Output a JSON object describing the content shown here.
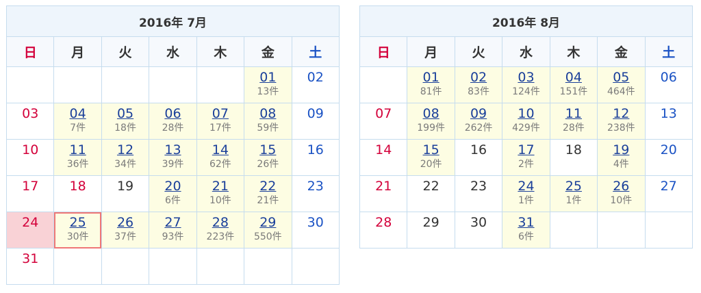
{
  "weekday_labels": [
    "日",
    "月",
    "火",
    "水",
    "木",
    "金",
    "土"
  ],
  "colors": {
    "sunday": "#d3003a",
    "saturday": "#1a52c4",
    "link": "#1a3f9a",
    "highlight": "#fdfde3",
    "today": "#f9d2d6",
    "selected_border": "#ef7676"
  },
  "calendars": [
    {
      "title": "2016年 7月",
      "weeks": [
        [
          null,
          null,
          null,
          null,
          null,
          {
            "day": "01",
            "count": "13件"
          },
          {
            "day": "02"
          }
        ],
        [
          {
            "day": "03"
          },
          {
            "day": "04",
            "count": "7件"
          },
          {
            "day": "05",
            "count": "18件"
          },
          {
            "day": "06",
            "count": "28件"
          },
          {
            "day": "07",
            "count": "17件"
          },
          {
            "day": "08",
            "count": "59件"
          },
          {
            "day": "09"
          }
        ],
        [
          {
            "day": "10"
          },
          {
            "day": "11",
            "count": "36件"
          },
          {
            "day": "12",
            "count": "34件"
          },
          {
            "day": "13",
            "count": "39件"
          },
          {
            "day": "14",
            "count": "62件"
          },
          {
            "day": "15",
            "count": "26件"
          },
          {
            "day": "16"
          }
        ],
        [
          {
            "day": "17"
          },
          {
            "day": "18",
            "holiday": true
          },
          {
            "day": "19"
          },
          {
            "day": "20",
            "count": "6件"
          },
          {
            "day": "21",
            "count": "10件"
          },
          {
            "day": "22",
            "count": "21件"
          },
          {
            "day": "23"
          }
        ],
        [
          {
            "day": "24",
            "today": true
          },
          {
            "day": "25",
            "count": "30件",
            "selected": true
          },
          {
            "day": "26",
            "count": "37件"
          },
          {
            "day": "27",
            "count": "93件"
          },
          {
            "day": "28",
            "count": "223件"
          },
          {
            "day": "29",
            "count": "550件"
          },
          {
            "day": "30"
          }
        ],
        [
          {
            "day": "31"
          },
          null,
          null,
          null,
          null,
          null,
          null
        ]
      ]
    },
    {
      "title": "2016年 8月",
      "weeks": [
        [
          null,
          {
            "day": "01",
            "count": "81件"
          },
          {
            "day": "02",
            "count": "83件"
          },
          {
            "day": "03",
            "count": "124件"
          },
          {
            "day": "04",
            "count": "151件"
          },
          {
            "day": "05",
            "count": "464件"
          },
          {
            "day": "06"
          }
        ],
        [
          {
            "day": "07"
          },
          {
            "day": "08",
            "count": "199件"
          },
          {
            "day": "09",
            "count": "262件"
          },
          {
            "day": "10",
            "count": "429件"
          },
          {
            "day": "11",
            "count": "28件"
          },
          {
            "day": "12",
            "count": "238件"
          },
          {
            "day": "13"
          }
        ],
        [
          {
            "day": "14"
          },
          {
            "day": "15",
            "count": "20件"
          },
          {
            "day": "16"
          },
          {
            "day": "17",
            "count": "2件"
          },
          {
            "day": "18"
          },
          {
            "day": "19",
            "count": "4件"
          },
          {
            "day": "20"
          }
        ],
        [
          {
            "day": "21"
          },
          {
            "day": "22"
          },
          {
            "day": "23"
          },
          {
            "day": "24",
            "count": "1件"
          },
          {
            "day": "25",
            "count": "1件"
          },
          {
            "day": "26",
            "count": "10件"
          },
          {
            "day": "27"
          }
        ],
        [
          {
            "day": "28"
          },
          {
            "day": "29"
          },
          {
            "day": "30"
          },
          {
            "day": "31",
            "count": "6件"
          },
          null,
          null,
          null
        ]
      ]
    }
  ]
}
